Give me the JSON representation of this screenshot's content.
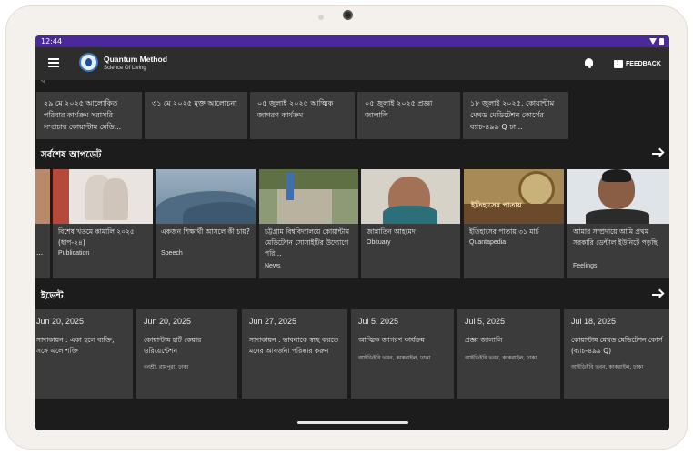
{
  "status": {
    "time": "12:44"
  },
  "app": {
    "title": "Quantum Method",
    "subtitle": "Science Of Living",
    "feedback_label": "FEEDBACK"
  },
  "news": [
    {
      "text": "২৯ মে ২০২৫ আলোকিত পরিবার কার্যক্রম সরাসরি সম্প্রচার কোয়ান্টাম মেডি..."
    },
    {
      "text": "৩১ মে ২০২৫ মুক্ত আলোচনা"
    },
    {
      "text": "০৫ জুলাই ২০২৫ আত্মিক জাগরণ কার্যক্রম"
    },
    {
      "text": "০৫ জুলাই ২০২৫ প্রজ্ঞা জালালি"
    },
    {
      "text": "১৮ জুলাই ২০২৫, কোয়ান্টাম মেথড মেডিটেশন কোর্সের ব্যাচ-৪৯৯ Q ঢা..."
    }
  ],
  "updates_section": {
    "title": "সর্বশেষ আপডেট"
  },
  "updates": [
    {
      "title": "...",
      "category": ""
    },
    {
      "title": "বিশেষ খতমে কামালি ২০২৫ (ধাপ-২৪)",
      "category": "Publication"
    },
    {
      "title": "একজন শিক্ষার্থী আসলে কী চায়?",
      "category": "Speech"
    },
    {
      "title": "চট্টগ্রাম বিশ্ববিদ্যালয়ে কোয়ান্টাম মেডিটেশন সোসাইটির উদ্যোগে পরি...",
      "category": "News"
    },
    {
      "title": "জান্নাতিন আহমেদ",
      "category": "Obituary"
    },
    {
      "title": "ইতিহাসের পাতায় ৩১ মার্চ",
      "category": "Quantapedia"
    },
    {
      "title": "আমার সম্প্রদায়ে আমি প্রথম সরকারি ডেন্টাল ইউনিটে পড়ছি",
      "category": "Feelings"
    }
  ],
  "quantapedia_banner": "ইতিহাসের পাতায়",
  "events_section": {
    "title": "ইভেন্ট"
  },
  "events": [
    {
      "date": "Jun 20, 2025",
      "title": "সাদাকায়ন : একা হলে ব্যক্তি, সঙ্গে এলে শক্তি",
      "location": ""
    },
    {
      "date": "Jun 20, 2025",
      "title": "কোয়ান্টাম হার্ট কেয়ার ওরিয়েন্টেশন",
      "location": "বনশ্রী, রামপুরা, ঢাকা"
    },
    {
      "date": "Jun 27, 2025",
      "title": "সাদাকায়ন : ভাবনাকে স্বচ্ছ করতে মনের আবর্জনা পরিষ্কার করুন",
      "location": ""
    },
    {
      "date": "Jul 5, 2025",
      "title": "আত্মিক জাগরণ কার্যক্রম",
      "location": "আইডিইবি ভবন, কাকরাইল, ঢাকা"
    },
    {
      "date": "Jul 5, 2025",
      "title": "প্রজ্ঞা জালালি",
      "location": "আইডিইবি ভবন, কাকরাইল, ঢাকা"
    },
    {
      "date": "Jul 18, 2025",
      "title": "কোয়ান্টাম মেথড মেডিটেশন কোর্স (ব্যাচ-৪৯৯ Q)",
      "location": "আইডিইবি ভবন, কাকরাইল, ঢাকা"
    }
  ],
  "colors": {
    "status_bar": "#4a2a9a",
    "app_bar": "#2d2d2d",
    "background": "#1c1c1c",
    "card": "#3b3b3b"
  }
}
